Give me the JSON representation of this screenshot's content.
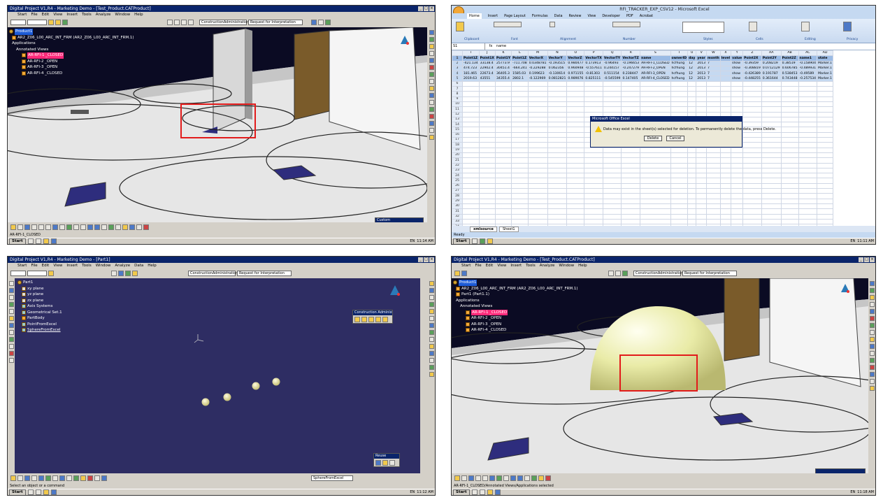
{
  "q1": {
    "title": "Digital Project V1,R4 - Marketing Demo - [Test_Product.CATProduct]",
    "menu": [
      "Start",
      "File",
      "Edit",
      "View",
      "Insert",
      "Tools",
      "Analyze",
      "Window",
      "Help"
    ],
    "workbench_combo": "ConstructionAdministration",
    "rfi_combo": "Request for Interpretation",
    "tree_root": "Product1",
    "tree_model": "AR2_Z06_L00_ARC_INT_FRM (AR2_Z06_L00_ARC_INT_FRM.1)",
    "tree_apps": "Applications",
    "tree_views": "Annotated Views",
    "tree_items": [
      "AR-RFI-1 _CLOSED",
      "AR-RFI-2 _OPEN",
      "AR-RFI-3 _OPEN",
      "AR-RFI-4 _CLOSED"
    ],
    "panel_title": "Custom",
    "status": "AR-RFI-1_CLOSED",
    "taskbar_start": "Start",
    "tray_lang": "EN",
    "tray_time": "11:14 AM"
  },
  "q2": {
    "title": "RFI_TRACKER_EXP_CSV12 - Microsoft Excel",
    "ribbon_tabs": [
      "Home",
      "Insert",
      "Page Layout",
      "Formulas",
      "Data",
      "Review",
      "View",
      "Developer",
      "PDF",
      "Acrobat"
    ],
    "groups": [
      "Clipboard",
      "Font",
      "Alignment",
      "Number",
      "Styles",
      "Cells",
      "Editing",
      "Privacy"
    ],
    "name_box": "S1",
    "formula": "name",
    "col_letters": [
      "I",
      "J",
      "K",
      "L",
      "M",
      "N",
      "O",
      "P",
      "Q",
      "R",
      "S",
      "T",
      "U",
      "V",
      "W",
      "X",
      "Y",
      "Z",
      "AA",
      "AB",
      "AC",
      "AD"
    ],
    "headers": [
      "Point1Z",
      "Point1X",
      "Point1Y",
      "Point1Z",
      "VectorX",
      "VectorY",
      "VectorZ",
      "VectorTX",
      "VectorTY",
      "VectorTZ",
      "name",
      "ownerID",
      "day",
      "year",
      "month",
      "level",
      "value",
      "Point2X",
      "Point2Y",
      "Point2Z",
      "name1",
      "state"
    ],
    "rows": [
      [
        "-421.134",
        "33138.4",
        "25773.9",
        "-711.708",
        "0.0348781",
        "-0.193515",
        "0.980477",
        "0.173913",
        "-0.96493",
        "-0.196653",
        "AR-RFI-1_CLOSED",
        "hcfhung",
        "12",
        "2013",
        "7",
        "",
        "show",
        "-0.39359",
        "0.208219",
        "0.38519",
        "-0.158904",
        "Marker.1"
      ],
      [
        "474.723",
        "22902.4",
        "30451.4",
        "-664.241",
        "-0.229288",
        "0.062356",
        "0.960948",
        "-0.557611",
        "0.244157",
        "-0.247279",
        "AR-RFI-2_OPEN",
        "hcfhung",
        "12",
        "2013",
        "7",
        "",
        "show",
        "-0.308819",
        "0.0712129",
        "0.606785",
        "-0.489931",
        "Marker.1"
      ],
      [
        "181.465",
        "22673.4",
        "36405.3",
        "1585.03",
        "0.199623",
        "-0.130614",
        "0.971155",
        "-0.81303",
        "0.511154",
        "0.238447",
        "AR-RFI-3_OPEN",
        "hcfhung",
        "12",
        "2013",
        "7",
        "",
        "show",
        "-0.426389",
        "0.191787",
        "0.538453",
        "-0.49589",
        "Marker.1"
      ],
      [
        "2019.63",
        "43551",
        "34355.4",
        "2802.1",
        "-0.122969",
        "0.0812821",
        "0.989076",
        "0.825111",
        "-0.545599",
        "0.147405",
        "AR-RFI-4_CLOSED",
        "hcfhung",
        "12",
        "2013",
        "7",
        "",
        "show",
        "-0.448255",
        "0.361644",
        "0.743448",
        "-0.257534",
        "Marker.1"
      ]
    ],
    "dialog_title": "Microsoft Office Excel",
    "dialog_msg": "Data may exist in the sheet(s) selected for deletion. To permanently delete the data, press Delete.",
    "btn_delete": "Delete",
    "btn_cancel": "Cancel",
    "sheet_tabs": [
      "xmlsource",
      "Sheet1"
    ],
    "status": "Ready",
    "tray_lang": "EN",
    "tray_time": "11:11 AM"
  },
  "q3": {
    "title": "Digital Project V1,R4 - Marketing Demo - [Part1]",
    "menu": [
      "Start",
      "File",
      "Edit",
      "View",
      "Insert",
      "Tools",
      "Window",
      "Analyze",
      "Data",
      "Help"
    ],
    "workbench_combo": "ConstructionAdministration",
    "rfi_combo": "Request for Interpretation",
    "tree": [
      "Part1",
      "xy plane",
      "yz plane",
      "zx plane",
      "Axis Systems",
      "Geometrical Set.1",
      "PartBody",
      "PointFromExcel",
      "SphereFromExcel"
    ],
    "panel_title": "Construction Administ...",
    "panel2_title": "Reuse",
    "bottom_combo": "SphereFromExcel",
    "status": "Select an object or a command",
    "tray_lang": "EN",
    "tray_time": "11:12 AM"
  },
  "q4": {
    "title": "Digital Project V1,R4 - Marketing Demo - [Test_Product.CATProduct]",
    "menu": [
      "Start",
      "File",
      "Edit",
      "View",
      "Insert",
      "Tools",
      "Analyze",
      "Window",
      "Help"
    ],
    "workbench_combo": "ConstructionAdministration",
    "rfi_combo": "Request for Interpretation",
    "tree_root": "Product1",
    "tree_model": "AR2_Z06_L00_ARC_INT_FRM (AR2_Z06_L00_ARC_INT_FRM.1)",
    "tree_part": "Part1 (Part1.1)",
    "tree_apps": "Applications",
    "tree_views": "Annotated Views",
    "tree_items": [
      "AR-RFI-1 _CLOSED",
      "AR-RFI-2 _OPEN",
      "AR-RFI-3 _OPEN",
      "AR-RFI-4 _CLOSED"
    ],
    "status": "AR-RFI-1_CLOSED/Annotated Views/Applications selected",
    "tray_lang": "EN",
    "tray_time": "11:18 AM"
  },
  "colors": {
    "title_bar": "#0a246a",
    "viewport_bg": "#2e2d63",
    "sky": "#0b0b23",
    "floor": "#e6e6e6",
    "highlight": "#e21b1b",
    "sphere": "#e9eba7"
  }
}
